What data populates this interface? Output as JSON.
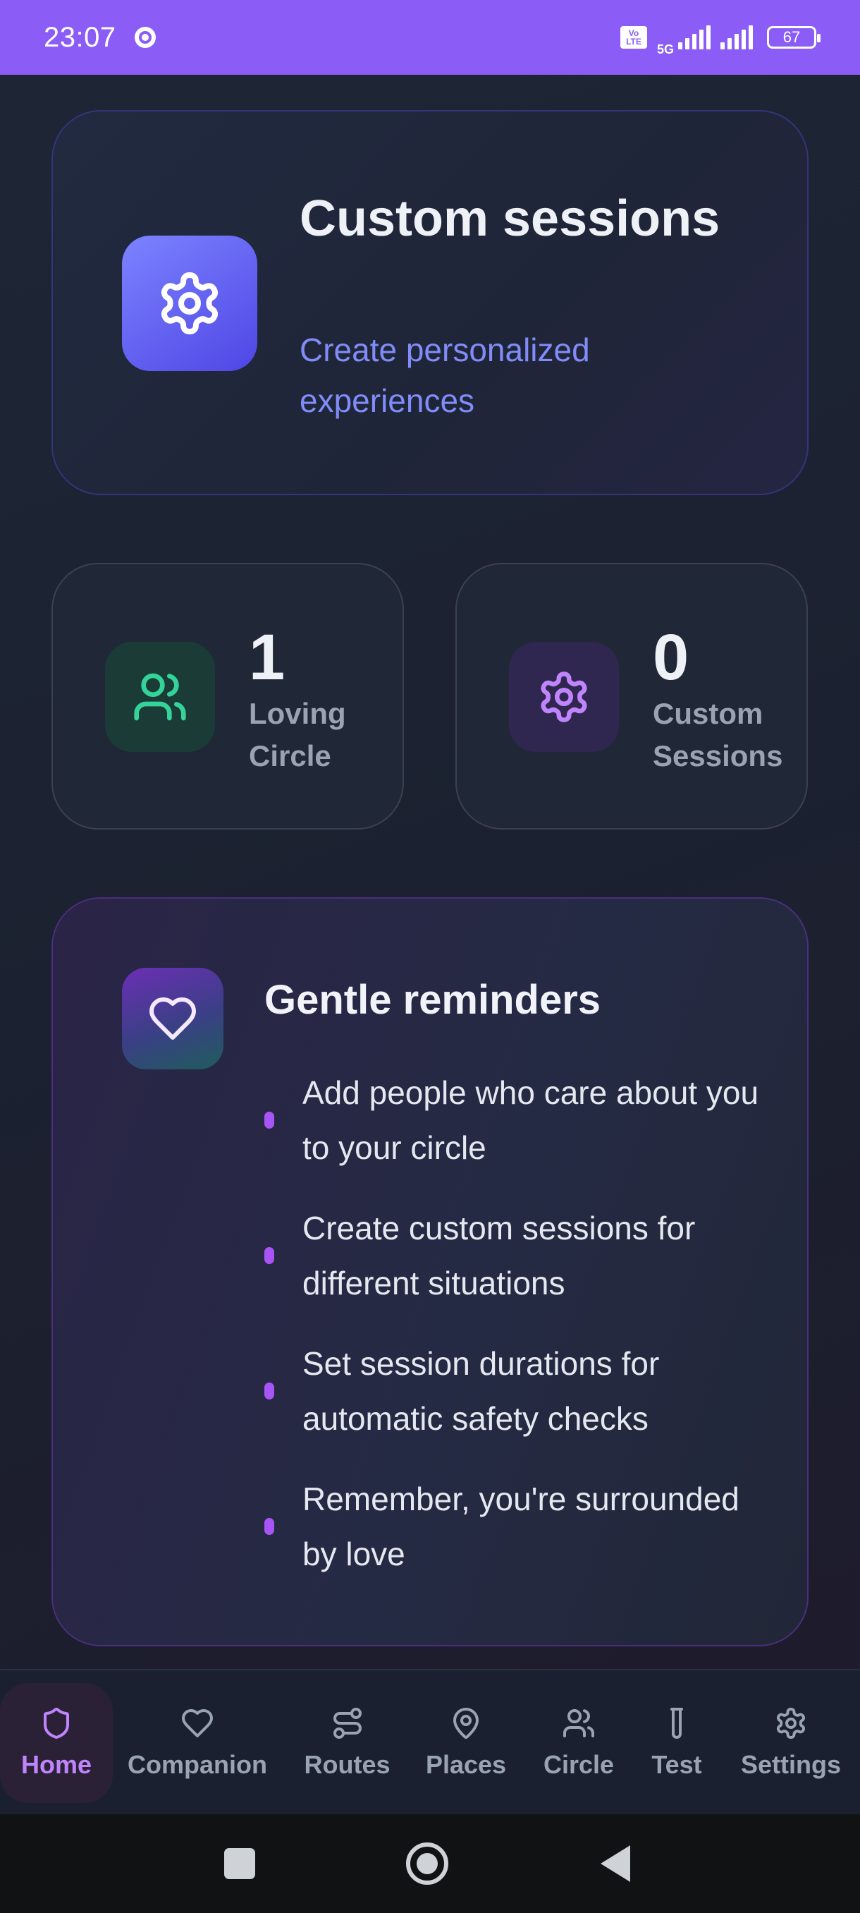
{
  "status_bar": {
    "time": "23:07",
    "network_badge": "Vo LTE",
    "network_type": "5G",
    "battery": "67",
    "icons": [
      "chrome-icon",
      "signal-icon",
      "battery-icon"
    ]
  },
  "hero": {
    "title": "Custom sessions",
    "subtitle": "Create personalized experiences",
    "icon": "gear-icon"
  },
  "stats": [
    {
      "value": "1",
      "label": "Loving Circle",
      "icon": "users-icon",
      "color": "#34d399"
    },
    {
      "value": "0",
      "label": "Custom Sessions",
      "icon": "gear-icon",
      "color": "#c084fc"
    }
  ],
  "reminders": {
    "title": "Gentle reminders",
    "icon": "heart-icon",
    "items": [
      "Add people who care about you to your circle",
      "Create custom sessions for different situations",
      "Set session durations for automatic safety checks",
      "Remember, you're surrounded by love"
    ]
  },
  "nav": {
    "active": "Home",
    "items": [
      {
        "label": "Home",
        "icon": "shield-icon"
      },
      {
        "label": "Companion",
        "icon": "heart-icon"
      },
      {
        "label": "Routes",
        "icon": "route-icon"
      },
      {
        "label": "Places",
        "icon": "map-pin-icon"
      },
      {
        "label": "Circle",
        "icon": "users-icon"
      },
      {
        "label": "Test",
        "icon": "test-tube-icon"
      },
      {
        "label": "Settings",
        "icon": "gear-icon"
      }
    ]
  },
  "system_nav": [
    "recents-button",
    "home-button",
    "back-button"
  ],
  "colors": {
    "accent": "#8b5cf6",
    "indigo": "#818cf8",
    "green": "#34d399",
    "purple": "#c084fc",
    "background": "#1d2331"
  }
}
